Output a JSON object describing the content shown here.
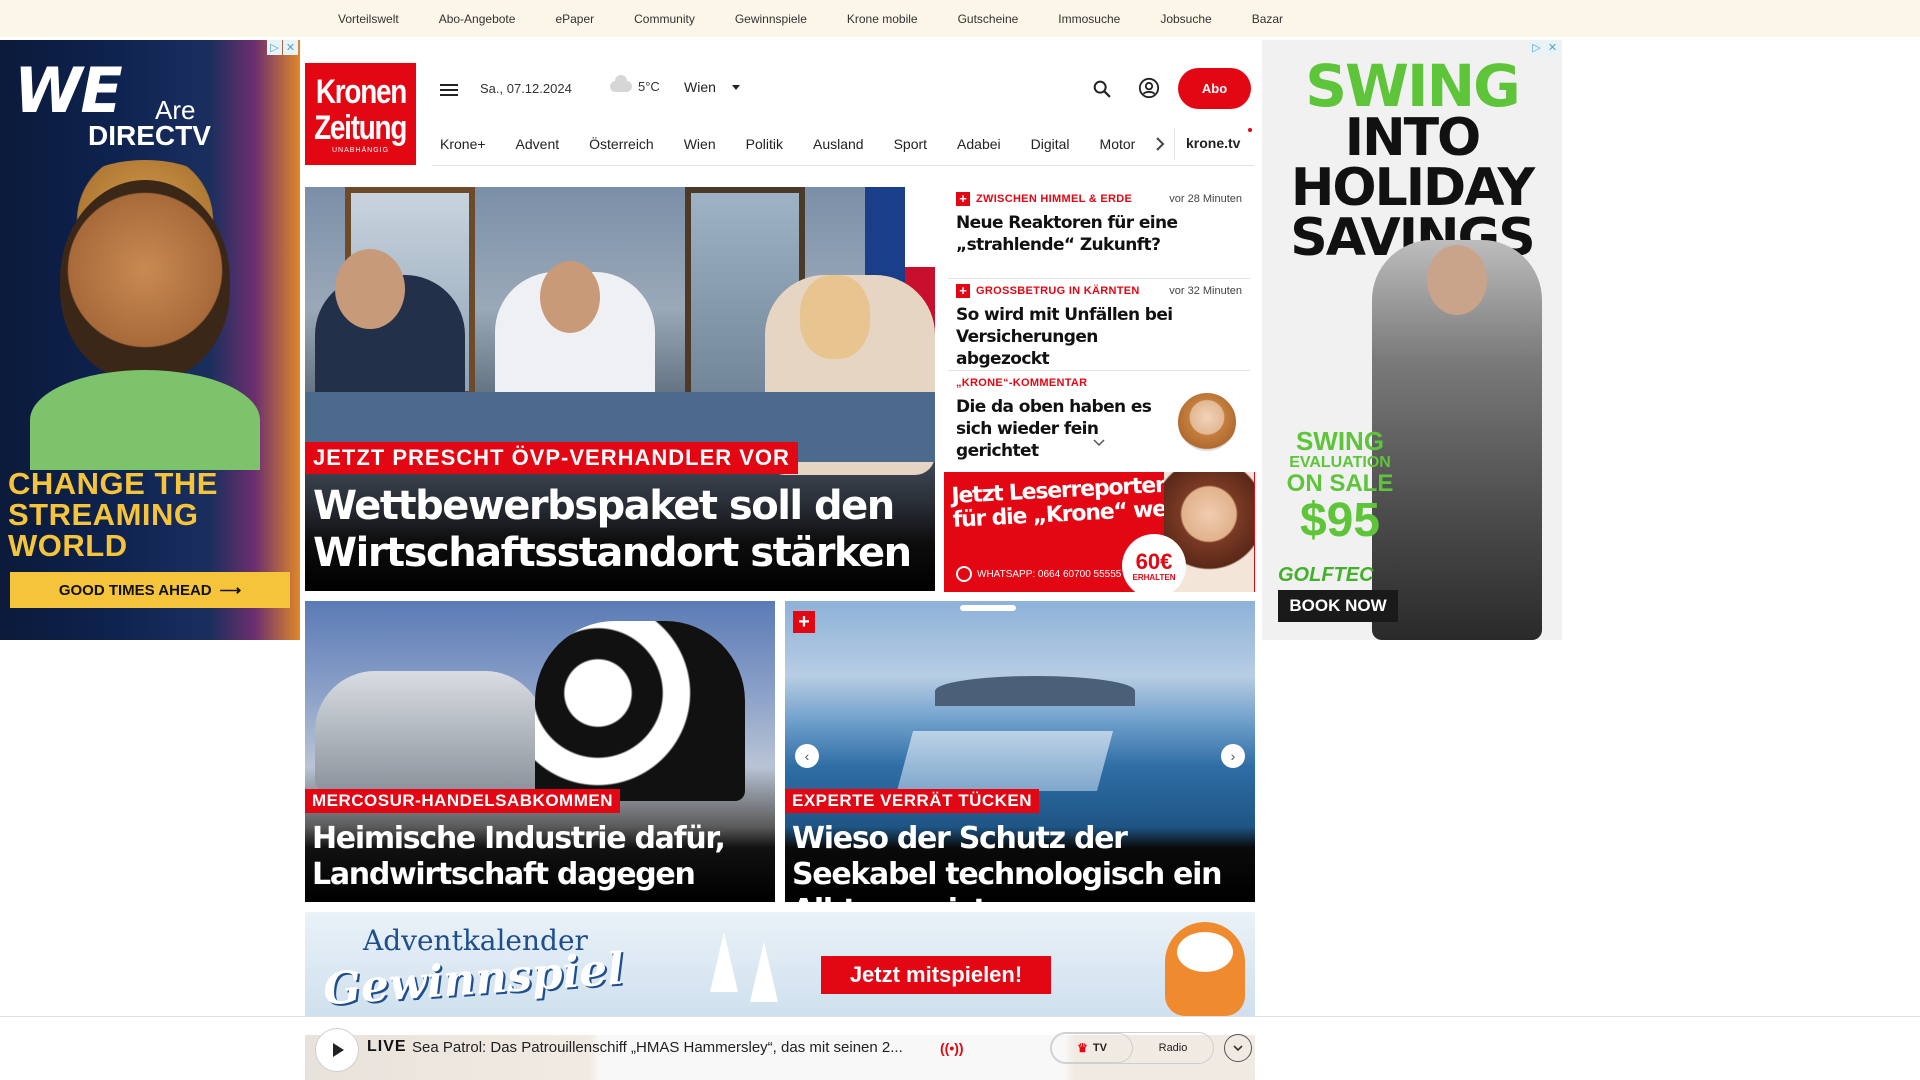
{
  "topbar": {
    "links": [
      "Vorteilswelt",
      "Abo-Angebote",
      "ePaper",
      "Community",
      "Gewinnspiele",
      "Krone mobile",
      "Gutscheine",
      "Immosuche",
      "Jobsuche",
      "Bazar"
    ]
  },
  "ad_left": {
    "headline_we": "WE",
    "headline_are": "Are",
    "headline_brand": "DIRECTV",
    "tagline": "CHANGE THE STREAMING WORLD",
    "cta": "GOOD TIMES AHEAD",
    "cta_arrow": "⟶"
  },
  "ad_right": {
    "line1": "SWING",
    "line2": "INTO",
    "line3": "HOLIDAY",
    "line4": "SAVINGS",
    "offer1": "SWING",
    "offer2": "EVALUATION",
    "offer3": "ON SALE",
    "price": "$95",
    "brand": "GOLFTEC",
    "cta": "BOOK NOW",
    "brand_color": "#43b02a"
  },
  "header": {
    "logo_line1": "Kronen",
    "logo_line2": "Zeitung",
    "logo_line3": "UNABHÄNGIG",
    "date": "Sa., 07.12.2024",
    "temperature": "5°C",
    "city": "Wien",
    "abo_label": "Abo",
    "accent_color": "#e30613"
  },
  "nav": {
    "items": [
      "Krone+",
      "Advent",
      "Österreich",
      "Wien",
      "Politik",
      "Ausland",
      "Sport",
      "Adabei",
      "Digital",
      "Motor"
    ],
    "tv_label": "krone.tv"
  },
  "hero": {
    "kicker": "JETZT PRESCHT ÖVP-VERHANDLER VOR",
    "title": "Wettbewerbspaket soll den Wirtschaftsstandort stärken"
  },
  "news": [
    {
      "kicker": "ZWISCHEN HIMMEL & ERDE",
      "time": "vor 28 Minuten",
      "title": "Neue Reaktoren für eine „strahlende“ Zukunft?",
      "plus": "+"
    },
    {
      "kicker": "GROSSBETRUG IN KÄRNTEN",
      "time": "vor 32 Minuten",
      "title": "So wird mit Unfällen bei Versicherungen abgezockt",
      "plus": "+"
    },
    {
      "kicker": "„KRONE“-KOMMENTAR",
      "time": "",
      "title": "Die da oben haben es sich wieder fein gerichtet",
      "plus": ""
    }
  ],
  "reporter_ad": {
    "line1": "Jetzt Leserreporter",
    "line2": "für die „Krone“ werden",
    "whatsapp": "WHATSAPP: 0664 60700 55555",
    "amount": "60€",
    "amount_label": "ERHALTEN"
  },
  "cards": [
    {
      "kicker": "MERCOSUR-HANDELSABKOMMEN",
      "title": "Heimische Industrie dafür, Landwirtschaft dagegen"
    },
    {
      "kicker": "EXPERTE VERRÄT TÜCKEN",
      "title": "Wieso der Schutz der Seekabel technologisch ein Albtraum ist",
      "plus": "+",
      "prev": "‹",
      "next": "›"
    }
  ],
  "advent": {
    "line1": "Adventkalender",
    "line2": "Gewinnspiel",
    "cta": "Jetzt mitspielen!"
  },
  "player": {
    "live_label": "LIVE",
    "text": "Sea Patrol: Das Patrouillenschiff „HMAS Hammersley“, das mit seinen 2...",
    "broadcast": "((•))",
    "tv_label": "TV",
    "radio_label": "Radio"
  },
  "ad_badges": {
    "info": "▷",
    "close": "✕"
  }
}
